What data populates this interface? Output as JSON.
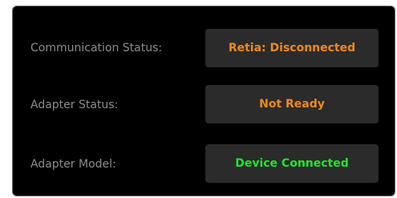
{
  "rows": [
    {
      "label": "Communication Status:",
      "value": "Retia: Disconnected",
      "value_color": "#f08a1c"
    },
    {
      "label": "Adapter Status:",
      "value": "Not Ready",
      "value_color": "#f08a1c"
    },
    {
      "label": "Adapter Model:",
      "value": "Device Connected",
      "value_color": "#1fe62a"
    }
  ],
  "colors": {
    "panel_bg": "#000000",
    "box_bg": "#2b2b2b",
    "label": "#8c8c8c"
  }
}
